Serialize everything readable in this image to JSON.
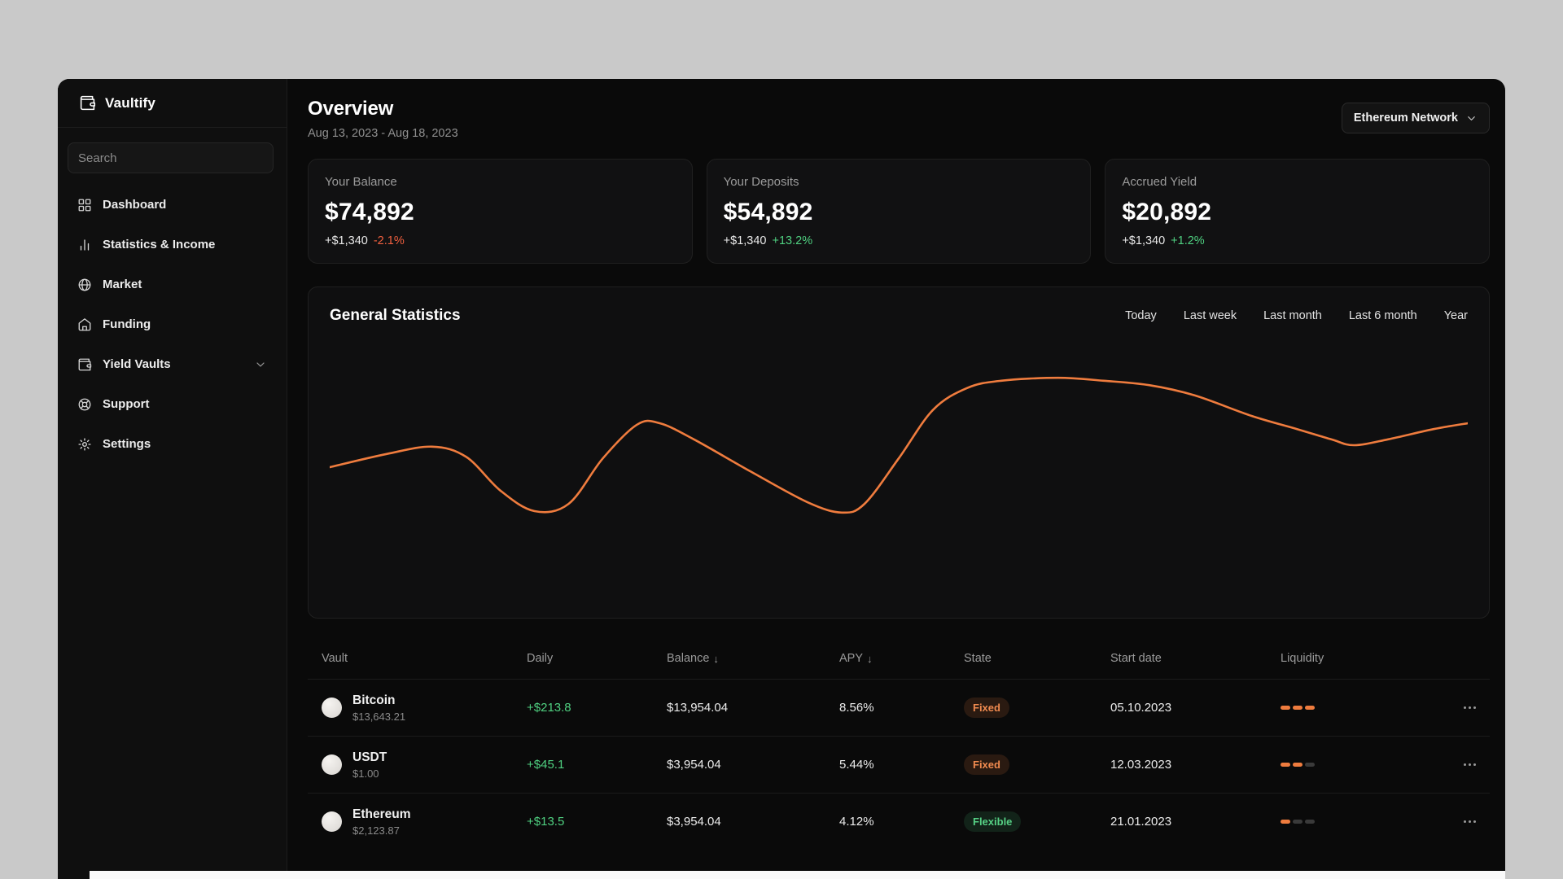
{
  "app": {
    "name": "Vaultify"
  },
  "colors": {
    "bg-outer": "#c9c9c9",
    "bg-app": "#0a0a0a",
    "bg-sidebar": "#0f0f0f",
    "accent": "#ef7c3e",
    "positive": "#4fd080",
    "negative": "#f1603f"
  },
  "sidebar": {
    "search_placeholder": "Search",
    "items": [
      {
        "label": "Dashboard",
        "icon": "dashboard-grid-icon"
      },
      {
        "label": "Statistics & Income",
        "icon": "bar-chart-icon"
      },
      {
        "label": "Market",
        "icon": "globe-icon"
      },
      {
        "label": "Funding",
        "icon": "home-icon"
      },
      {
        "label": "Yield Vaults",
        "icon": "wallet-icon",
        "has_chevron": true
      },
      {
        "label": "Support",
        "icon": "lifebuoy-icon"
      },
      {
        "label": "Settings",
        "icon": "gear-icon"
      }
    ]
  },
  "header": {
    "title": "Overview",
    "date_range": "Aug 13, 2023 - Aug 18, 2023",
    "network_selector": "Ethereum Network"
  },
  "stat_cards": [
    {
      "label": "Your Balance",
      "value": "$74,892",
      "change_amount": "+$1,340",
      "change_percent": "-2.1%",
      "change_direction": "down"
    },
    {
      "label": "Your Deposits",
      "value": "$54,892",
      "change_amount": "+$1,340",
      "change_percent": "+13.2%",
      "change_direction": "up"
    },
    {
      "label": "Accrued Yield",
      "value": "$20,892",
      "change_amount": "+$1,340",
      "change_percent": "+1.2%",
      "change_direction": "up"
    }
  ],
  "statistics": {
    "title": "General Statistics",
    "tabs": [
      "Today",
      "Last week",
      "Last month",
      "Last 6 month",
      "Year"
    ]
  },
  "chart_data": {
    "type": "line",
    "title": "General Statistics",
    "x_axis": {
      "visible": false
    },
    "y_axis": {
      "visible": false,
      "scale": "normalized 0-100 (no axis labels shown)"
    },
    "grid": false,
    "legend": "none",
    "series": [
      {
        "name": "portfolio-value",
        "color": "#ef7c3e",
        "points": [
          [
            0,
            35
          ],
          [
            5,
            44
          ],
          [
            9,
            49
          ],
          [
            12,
            42
          ],
          [
            15,
            19
          ],
          [
            18,
            5
          ],
          [
            21,
            10
          ],
          [
            24,
            41
          ],
          [
            27,
            64
          ],
          [
            29,
            65
          ],
          [
            32,
            54
          ],
          [
            37,
            32
          ],
          [
            42,
            11
          ],
          [
            45,
            4
          ],
          [
            47,
            10
          ],
          [
            50,
            41
          ],
          [
            53,
            74
          ],
          [
            56,
            89
          ],
          [
            59,
            94
          ],
          [
            64,
            96
          ],
          [
            68,
            94
          ],
          [
            72,
            91
          ],
          [
            76,
            84
          ],
          [
            81,
            70
          ],
          [
            85,
            61
          ],
          [
            88,
            54
          ],
          [
            90,
            50
          ],
          [
            93,
            54
          ],
          [
            97,
            61
          ],
          [
            100,
            65
          ]
        ]
      }
    ]
  },
  "table": {
    "columns": [
      "Vault",
      "Daily",
      "Balance",
      "APY",
      "State",
      "Start date",
      "Liquidity"
    ],
    "sorted_columns": [
      "Balance",
      "APY"
    ],
    "rows": [
      {
        "vault": "Bitcoin",
        "price": "$13,643.21",
        "daily": "+$213.8",
        "balance": "$13,954.04",
        "apy": "8.56%",
        "state": "Fixed",
        "state_type": "fixed",
        "start_date": "05.10.2023",
        "liquidity": 3
      },
      {
        "vault": "USDT",
        "price": "$1.00",
        "daily": "+$45.1",
        "balance": "$3,954.04",
        "apy": "5.44%",
        "state": "Fixed",
        "state_type": "fixed",
        "start_date": "12.03.2023",
        "liquidity": 2
      },
      {
        "vault": "Ethereum",
        "price": "$2,123.87",
        "daily": "+$13.5",
        "balance": "$3,954.04",
        "apy": "4.12%",
        "state": "Flexible",
        "state_type": "flexible",
        "start_date": "21.01.2023",
        "liquidity": 1
      }
    ]
  }
}
